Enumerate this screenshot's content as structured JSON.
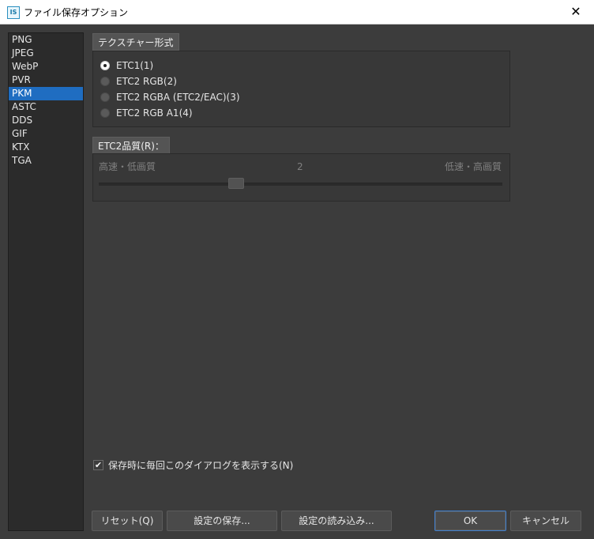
{
  "window": {
    "icon_text": "IS",
    "title": "ファイル保存オプション",
    "close_glyph": "✕"
  },
  "formats": {
    "items": [
      "PNG",
      "JPEG",
      "WebP",
      "PVR",
      "PKM",
      "ASTC",
      "DDS",
      "GIF",
      "KTX",
      "TGA"
    ],
    "selected": "PKM"
  },
  "texture_format": {
    "header": "テクスチャー形式",
    "options": [
      {
        "label": "ETC1(1)",
        "checked": true
      },
      {
        "label": "ETC2 RGB(2)",
        "checked": false
      },
      {
        "label": "ETC2 RGBA (ETC2/EAC)(3)",
        "checked": false
      },
      {
        "label": "ETC2 RGB A1(4)",
        "checked": false
      }
    ]
  },
  "etc2_quality": {
    "header": "ETC2品質(R)：",
    "left_label": "高速・低画質",
    "right_label": "低速・高画質",
    "value_text": "2",
    "value": 2,
    "min": 0,
    "max": 6
  },
  "show_dialog_checkbox": {
    "label": "保存時に毎回このダイアログを表示する(N)",
    "checked": true,
    "check_glyph": "✔"
  },
  "buttons": {
    "reset": "リセット(Q)",
    "save_settings": "設定の保存...",
    "load_settings": "設定の読み込み...",
    "ok": "OK",
    "cancel": "キャンセル"
  },
  "colors": {
    "background": "#3c3c3c",
    "list_background": "#2b2b2b",
    "selection": "#1f6dc1",
    "default_button_border": "#3f7fcf"
  }
}
